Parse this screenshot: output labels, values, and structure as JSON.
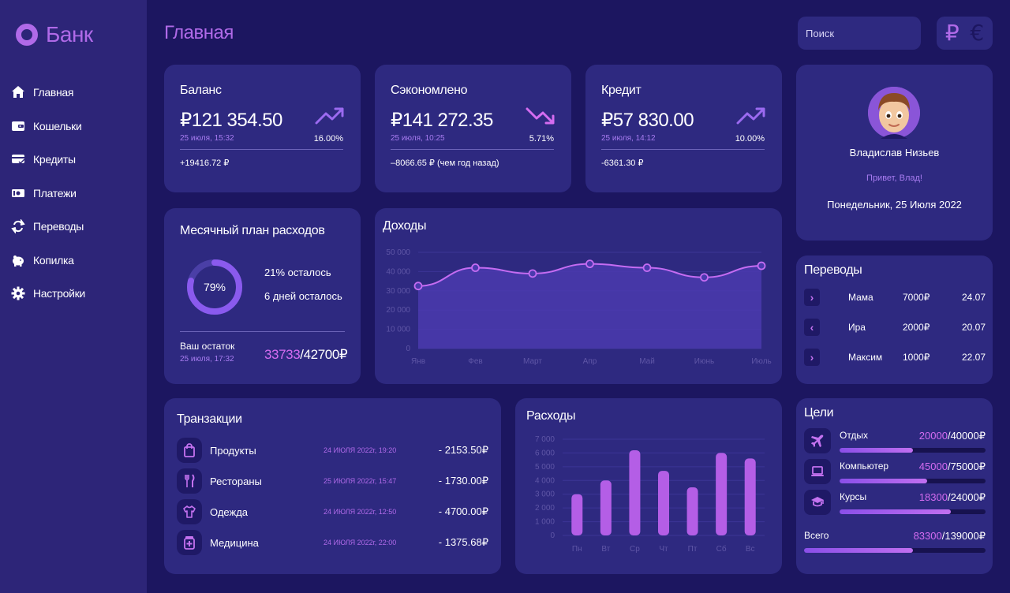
{
  "brand": {
    "name": "Банк"
  },
  "sidebar": {
    "items": [
      {
        "label": "Главная",
        "icon": "home-icon"
      },
      {
        "label": "Кошельки",
        "icon": "wallet-icon"
      },
      {
        "label": "Кредиты",
        "icon": "credit-card-icon"
      },
      {
        "label": "Платежи",
        "icon": "payments-icon"
      },
      {
        "label": "Переводы",
        "icon": "transfer-icon"
      },
      {
        "label": "Копилка",
        "icon": "piggy-bank-icon"
      },
      {
        "label": "Настройки",
        "icon": "gear-icon"
      }
    ]
  },
  "header": {
    "title": "Главная",
    "search_placeholder": "Поиск",
    "currency_rub": "₽",
    "currency_eur": "€"
  },
  "stats": [
    {
      "title": "Баланс",
      "value": "₽121 354.50",
      "date": "25 июля, 15:32",
      "percent": "16.00%",
      "change": "+19416.72 ₽",
      "trend": "up"
    },
    {
      "title": "Сэкономлено",
      "value": "₽141 272.35",
      "date": "25 июля, 10:25",
      "percent": "5.71%",
      "change": "–8066.65 ₽ (чем год назад)",
      "trend": "down"
    },
    {
      "title": "Кредит",
      "value": "₽57 830.00",
      "date": "25 июля, 14:12",
      "percent": "10.00%",
      "change": "-6361.30 ₽",
      "trend": "up"
    }
  ],
  "profile": {
    "name": "Владислав Низьев",
    "greeting": "Привет, Влад!",
    "date": "Понедельник, 25 Июля 2022"
  },
  "plan": {
    "title": "Месячный план расходов",
    "percent_label": "79%",
    "percent": 79,
    "left_percent": "21% осталось",
    "days_left": "6 дней осталось",
    "remaining_title": "Ваш остаток",
    "remaining_date": "25 июля, 17:32",
    "remaining_current": "33733",
    "remaining_total": "/42700₽"
  },
  "income": {
    "title": "Доходы",
    "chart_data": {
      "type": "area",
      "categories": [
        "Янв",
        "Фев",
        "Март",
        "Апр",
        "Май",
        "Июнь",
        "Июль"
      ],
      "values": [
        32500,
        42000,
        39000,
        44000,
        42000,
        37000,
        43000
      ],
      "ylim": [
        0,
        50000
      ],
      "yticks": [
        "0",
        "10 000",
        "20 000",
        "30 000",
        "40 000",
        "50 000"
      ],
      "grid": true
    }
  },
  "transfers": {
    "title": "Переводы",
    "items": [
      {
        "direction": "out",
        "name": "Мама",
        "amount": "7000₽",
        "date": "24.07"
      },
      {
        "direction": "in",
        "name": "Ира",
        "amount": "2000₽",
        "date": "20.07"
      },
      {
        "direction": "out",
        "name": "Максим",
        "amount": "1000₽",
        "date": "22.07"
      }
    ]
  },
  "transactions": {
    "title": "Транзакции",
    "items": [
      {
        "icon": "shopping-bag-icon",
        "name": "Продукты",
        "date": "24 ИЮЛЯ 2022г, 19:20",
        "amount": "- 2153.50₽"
      },
      {
        "icon": "cutlery-icon",
        "name": "Рестораны",
        "date": "25 ИЮЛЯ 2022г, 15:47",
        "amount": "- 1730.00₽"
      },
      {
        "icon": "clothes-icon",
        "name": "Одежда",
        "date": "24 ИЮЛЯ 2022г, 12:50",
        "amount": "- 4700.00₽"
      },
      {
        "icon": "medicine-icon",
        "name": "Медицина",
        "date": "24 ИЮЛЯ 2022г, 22:00",
        "amount": "- 1375.68₽"
      }
    ]
  },
  "expenses": {
    "title": "Расходы",
    "chart_data": {
      "type": "bar",
      "categories": [
        "Пн",
        "Вт",
        "Ср",
        "Чт",
        "Пт",
        "Сб",
        "Вс"
      ],
      "values": [
        3000,
        4000,
        6200,
        4700,
        3500,
        6000,
        5600
      ],
      "ylim": [
        0,
        7000
      ],
      "yticks": [
        "0",
        "1 000",
        "2 000",
        "3 000",
        "4 000",
        "5 000",
        "6 000",
        "7 000"
      ],
      "grid": true
    }
  },
  "goals": {
    "title": "Цели",
    "items": [
      {
        "icon": "airplane-icon",
        "name": "Отдых",
        "current": "20000",
        "total": "/40000₽",
        "progress": 0.5
      },
      {
        "icon": "laptop-icon",
        "name": "Компьютер",
        "current": "45000",
        "total": "/75000₽",
        "progress": 0.6
      },
      {
        "icon": "graduation-cap-icon",
        "name": "Курсы",
        "current": "18300",
        "total": "/24000₽",
        "progress": 0.7625
      }
    ],
    "total_label": "Всего",
    "total_current": "83300",
    "total_total": "/139000₽",
    "total_progress": 0.5993
  },
  "colors": {
    "background": "#1c1660",
    "sidebar": "#2d2578",
    "card": "#2e2980",
    "accent": "#b06ae8",
    "accent_pink": "#d46cf0"
  }
}
